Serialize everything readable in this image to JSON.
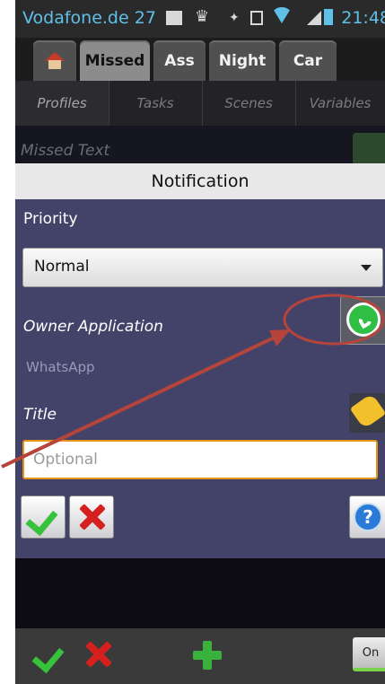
{
  "status_bar": {
    "carrier": "Vodafone.de 27",
    "time": "21:48"
  },
  "project_tabs": [
    {
      "label": "",
      "icon": "home-icon"
    },
    {
      "label": "Missed",
      "active": true
    },
    {
      "label": "Ass"
    },
    {
      "label": "Night"
    },
    {
      "label": "Car"
    }
  ],
  "sub_tabs": [
    "Profiles",
    "Tasks",
    "Scenes",
    "Variables"
  ],
  "background_row": {
    "label": "Missed Text"
  },
  "dialog": {
    "title": "Notification",
    "priority_label": "Priority",
    "priority_value": "Normal",
    "owner_label": "Owner Application",
    "owner_value": "WhatsApp",
    "owner_icon": "whatsapp-icon",
    "title_label": "Title",
    "title_placeholder": "Optional",
    "title_value": "",
    "help_glyph": "?"
  },
  "bottom_bar": {
    "toggle_label": "On"
  },
  "colors": {
    "dialog_bg": "#43436a",
    "annotation": "#b5453a",
    "status_text": "#5fc0e8",
    "input_focus": "#e8921a"
  }
}
